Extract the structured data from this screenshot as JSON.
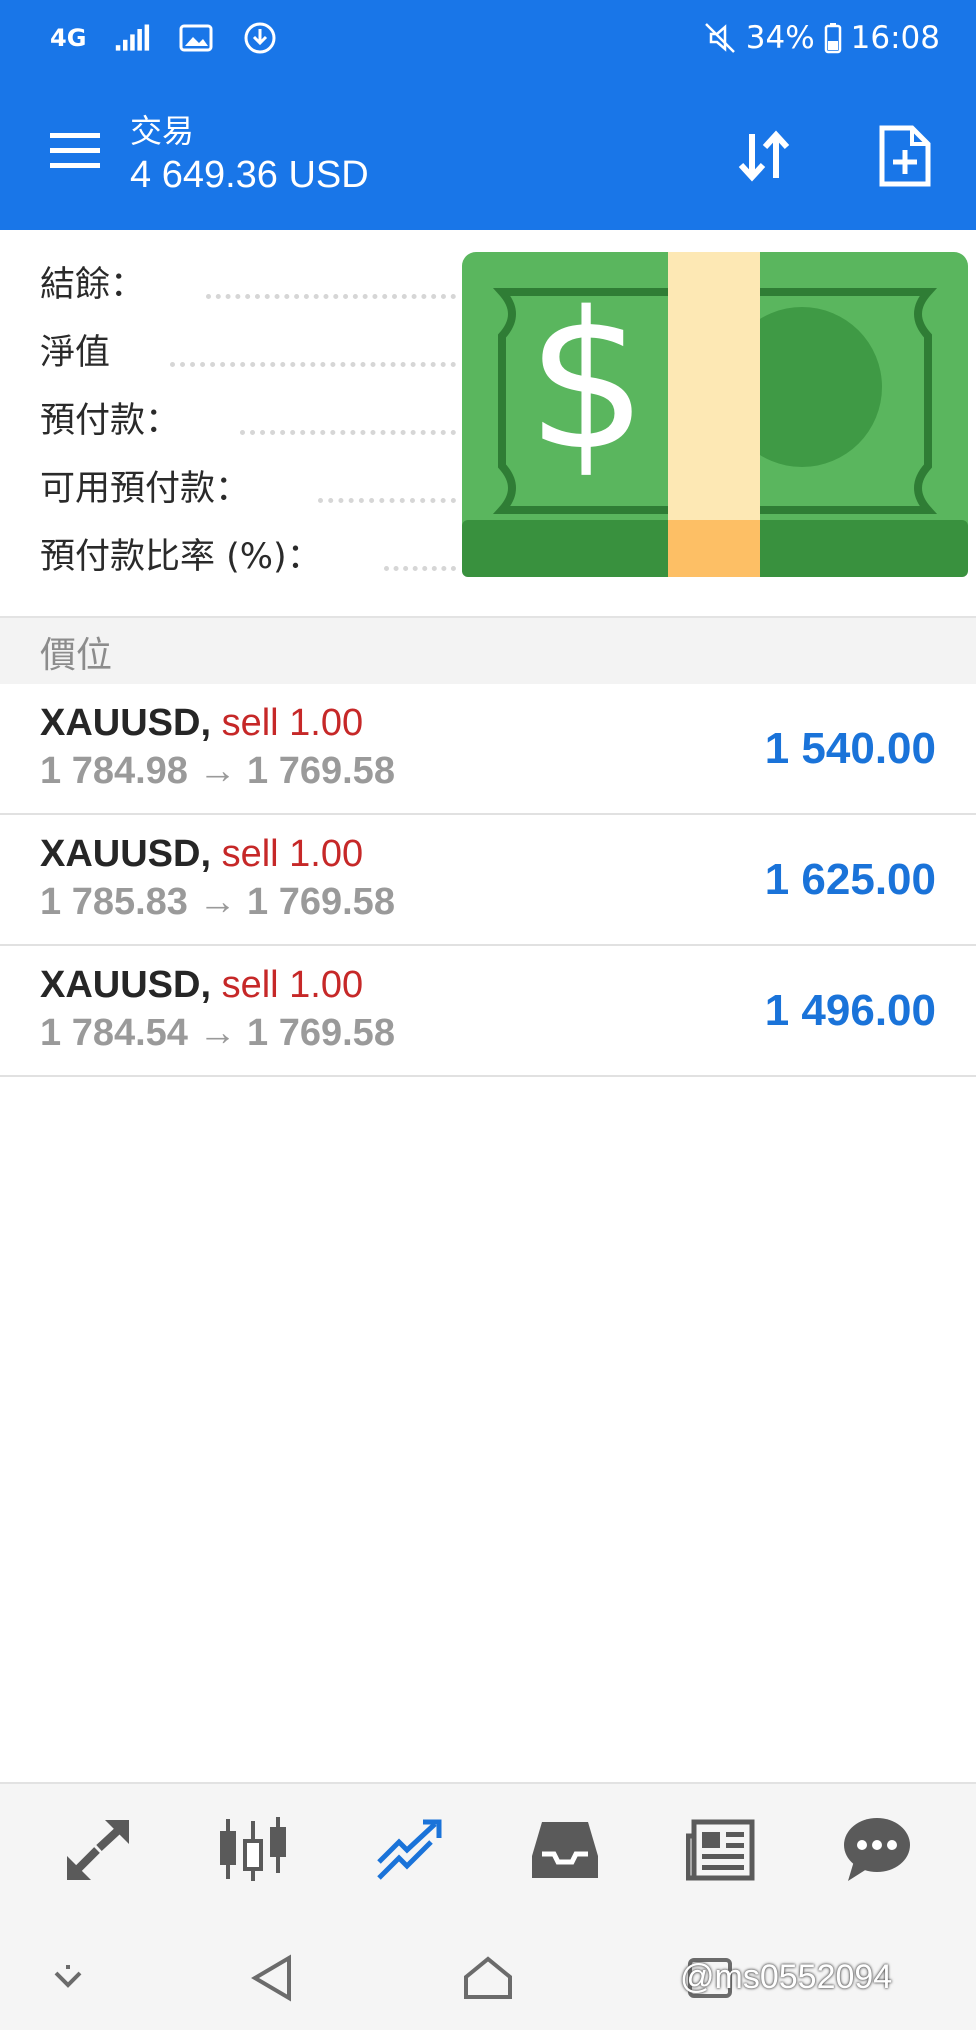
{
  "status_bar": {
    "network": "4G",
    "battery": "34%",
    "time": "16:08",
    "icons": [
      "signal-icon",
      "image-icon",
      "download-icon",
      "mute-icon",
      "battery-icon"
    ]
  },
  "app_bar": {
    "title": "交易",
    "balance": "4 649.36 USD",
    "icons": [
      "menu-icon",
      "sort-icon",
      "new-order-icon"
    ]
  },
  "summary": {
    "rows": [
      {
        "label": "結餘："
      },
      {
        "label": "淨值"
      },
      {
        "label": "預付款："
      },
      {
        "label": "可用預付款："
      },
      {
        "label": "預付款比率 (%)："
      }
    ],
    "overlay": "money-emoji-icon"
  },
  "positions": {
    "header": "價位",
    "items": [
      {
        "symbol": "XAUUSD,",
        "side": "sell 1.00",
        "prices": "1 784.98 → 1 769.58",
        "profit": "1 540.00"
      },
      {
        "symbol": "XAUUSD,",
        "side": "sell 1.00",
        "prices": "1 785.83 → 1 769.58",
        "profit": "1 625.00"
      },
      {
        "symbol": "XAUUSD,",
        "side": "sell 1.00",
        "prices": "1 784.54 → 1 769.58",
        "profit": "1 496.00"
      }
    ]
  },
  "bottom_nav": {
    "items": [
      "quotes-icon",
      "chart-icon",
      "trade-icon",
      "history-icon",
      "news-icon",
      "chat-icon"
    ],
    "active": "trade-icon",
    "active_color": "#1a73d9",
    "inactive_color": "#5a5a5a"
  },
  "system_nav": {
    "items": [
      "collapse-icon",
      "back-icon",
      "home-icon",
      "recents-icon"
    ]
  },
  "watermark": "@ms0552094",
  "colors": {
    "accent": "#1976e8",
    "sell": "#c62828",
    "profit": "#1a73d9"
  }
}
